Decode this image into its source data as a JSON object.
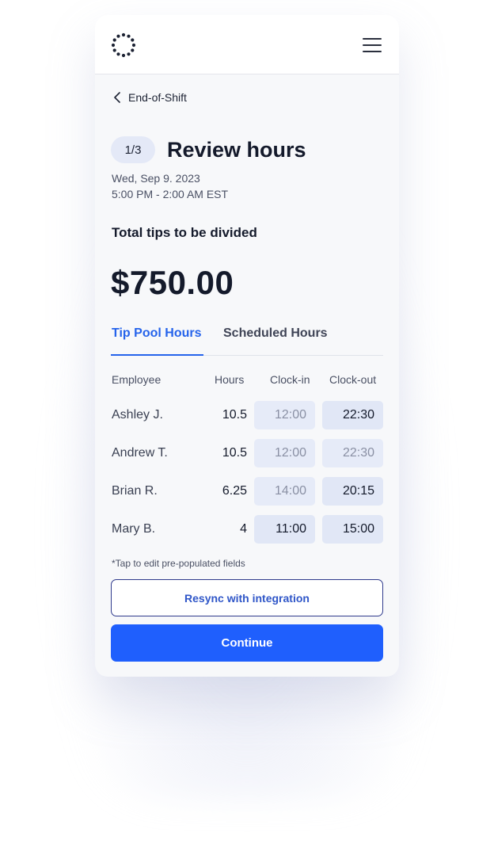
{
  "header": {
    "logo_icon": "dotted-ring-logo",
    "menu_icon": "hamburger-menu-icon"
  },
  "nav": {
    "back_label": "End-of-Shift",
    "back_icon": "chevron-left-icon"
  },
  "page": {
    "step": "1/3",
    "title": "Review hours",
    "date": "Wed, Sep 9. 2023",
    "time_range": "5:00 PM - 2:00 AM EST"
  },
  "tips": {
    "label": "Total tips to be divided",
    "amount": "$750.00"
  },
  "tabs": [
    {
      "label": "Tip Pool Hours",
      "active": true
    },
    {
      "label": "Scheduled Hours",
      "active": false
    }
  ],
  "table": {
    "headers": {
      "employee": "Employee",
      "hours": "Hours",
      "clock_in": "Clock-in",
      "clock_out": "Clock-out"
    },
    "rows": [
      {
        "name": "Ashley J.",
        "hours": "10.5",
        "clock_in": "12:00",
        "clock_out": "22:30"
      },
      {
        "name": "Andrew T.",
        "hours": "10.5",
        "clock_in": "12:00",
        "clock_out": "22:30"
      },
      {
        "name": "Brian R.",
        "hours": "6.25",
        "clock_in": "14:00",
        "clock_out": "20:15"
      },
      {
        "name": "Mary B.",
        "hours": "4",
        "clock_in": "11:00",
        "clock_out": "15:00"
      }
    ]
  },
  "footnote": "*Tap to edit pre-populated fields",
  "buttons": {
    "resync": "Resync with integration",
    "continue": "Continue"
  },
  "colors": {
    "accent": "#1f5ffd",
    "tab_active": "#2563eb",
    "cell_bg": "#e4e9f7"
  }
}
